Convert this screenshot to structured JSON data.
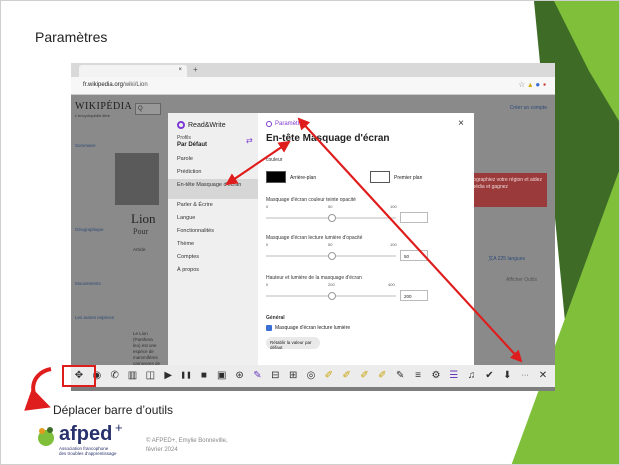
{
  "slide": {
    "title": "Paramètres",
    "caption": "Déplacer barre d’outils",
    "credit_line1": "© AFPED+, Emylie Bonneville,",
    "credit_line2": "février 2024",
    "logo_name": "afped",
    "logo_plus": "+",
    "logo_sub_line1": "Association francophone",
    "logo_sub_line2": "des troubles d’apprentissage",
    "colors": {
      "accent_green": "#7fbf3a",
      "dark_green": "#3e6b26",
      "arrow_red": "#e01d1d",
      "brand_purple": "#7b3bd1",
      "brand_navy": "#27316b"
    }
  },
  "browser": {
    "tab_title": "",
    "tab_close": "×",
    "tab_add": "+",
    "url_prefix": "fr.wikipedia.org",
    "url_path": "/wiki/Lion",
    "ext_icons": [
      "star-icon",
      "bookmark-icon",
      "rw-extension-icon",
      "menu-icon"
    ]
  },
  "wiki": {
    "logo": "WIKIPÉDIA",
    "subtitle": "L'encyclopédie libre",
    "search": "Q",
    "top_right": "Créer un compte",
    "article_heading": "Lion",
    "article_sub": "Pour",
    "nav_item_1": "Article",
    "banner": "Photographiez votre région et aidez Wikipédia et gagnez",
    "langs": "文A 225 langues",
    "tools": "Afficher   Outils",
    "left_text_1": "Sommaire",
    "left_text_2": "Géographique",
    "left_text_3": "Mouvements",
    "left_text_4": "Les autres espèces",
    "body_text": "Le Lion (Panthera leo) est une espèce de mammifères carnivores de la famille des Félidés."
  },
  "readwrite": {
    "logo": "Read&Write",
    "profile_label": "Profils",
    "profile_value": "Par Défaut",
    "menu": [
      "Parole",
      "Prédiction",
      "En-tête Masquage d'écran",
      "Parler & Écrire",
      "Langue",
      "Fonctionnalités",
      "Thème",
      "Comptes",
      "À propos"
    ],
    "active_index": 2,
    "breadcrumb": "Paramètres",
    "close": "×",
    "title": "En-tête Masquage d'écran",
    "color_label": "couleur",
    "bg_label": "Arrière-plan",
    "fg_label": "Premier plan",
    "bg_color": "#000000",
    "fg_color": "#ffffff",
    "slider1_label": "Masquage d'écran couleur teinte opacité",
    "slider1_ticks": [
      "0",
      "50",
      "100"
    ],
    "slider1_value": "",
    "slider2_label": "Masquage d'écran lecture lumière d'opacité",
    "slider2_ticks": [
      "0",
      "50",
      "100"
    ],
    "slider2_value": "50",
    "slider3_label": "Hauteur et lumière de la masquage d'écran",
    "slider3_ticks": [
      "0",
      "200",
      "400"
    ],
    "slider3_value": "200",
    "general_label": "Général",
    "checkbox_label": "Masquage d'écran lecture lumière",
    "reset_label": "Rétablir la valeur par défaut"
  },
  "toolbar": {
    "icons": [
      "move-icon",
      "logo-icon",
      "speak-icon",
      "book-icon",
      "screenshot-icon",
      "play-icon",
      "pause-icon",
      "stop-icon",
      "screen-mask-icon",
      "translate-icon",
      "prediction-icon",
      "dictionary-icon",
      "picture-dictionary-icon",
      "audio-maker-icon",
      "highlight-cyan-icon",
      "highlight-yellow-icon",
      "highlight-green-icon",
      "highlight-pink-icon",
      "collect-highlights-icon",
      "simplify-icon",
      "settings-icon",
      "vocab-icon",
      "voice-note-icon",
      "check-it-icon",
      "save-icon",
      "more-icon",
      "close-icon"
    ],
    "glyphs": [
      "✥",
      "◉",
      "✆",
      "▥",
      "◫",
      "▶",
      "❚❚",
      "■",
      "▣",
      "⊛",
      "✎",
      "⊟",
      "⊞",
      "◎",
      "✐",
      "✐",
      "✐",
      "✐",
      "✎",
      "≡",
      "⚙",
      "☰",
      "♫",
      "✔",
      "⬇",
      "···",
      "✕"
    ]
  }
}
